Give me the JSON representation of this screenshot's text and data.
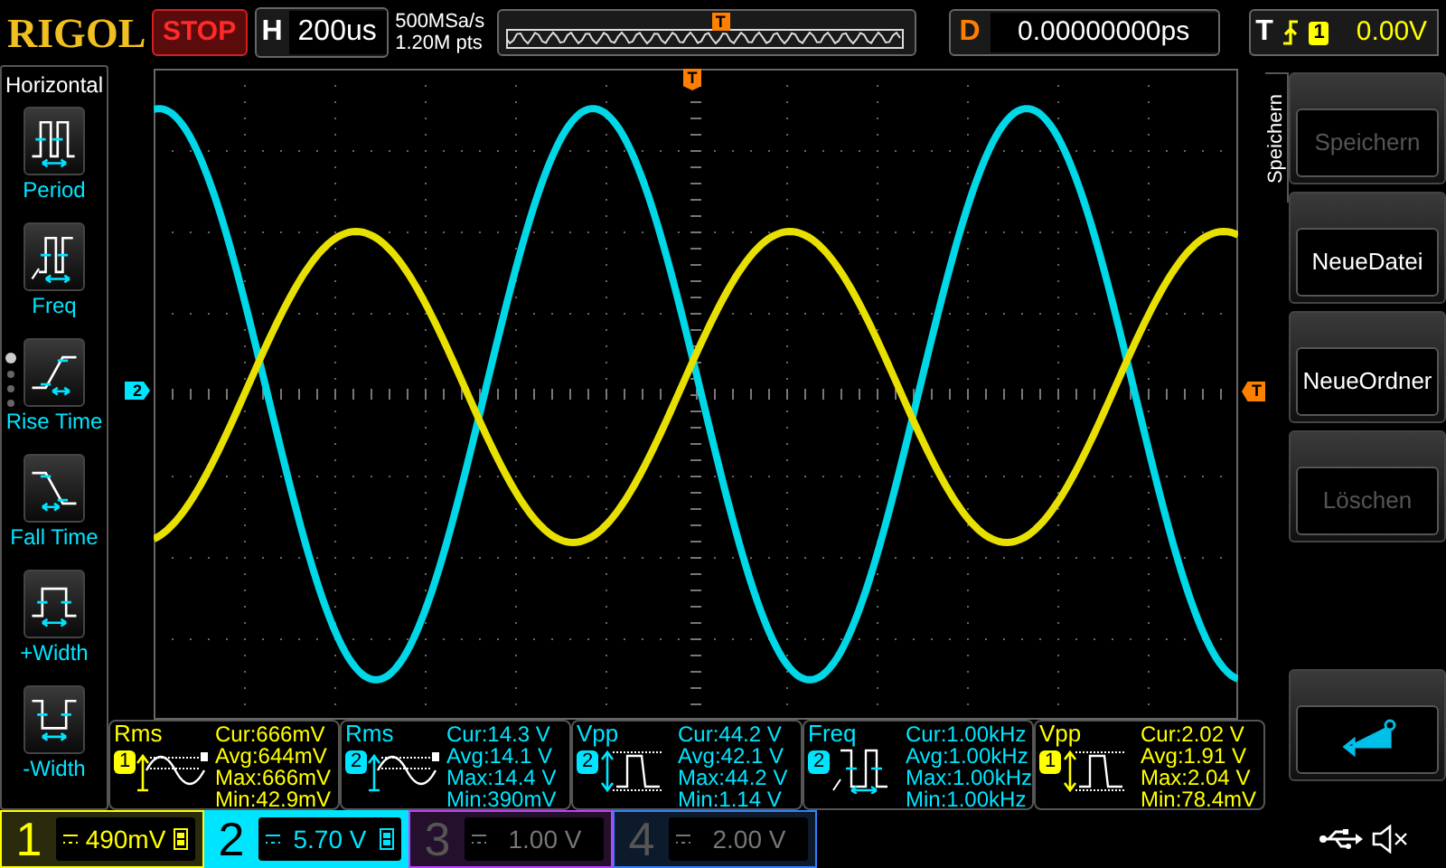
{
  "top_bar": {
    "logo": "RIGOL",
    "run_state": "STOP",
    "horizontal": {
      "label": "H",
      "timebase": "200us"
    },
    "sample_rate": "500MSa/s",
    "memory_depth": "1.20M pts",
    "memory_trigger": "T",
    "delay": {
      "label": "D",
      "value": "0.00000000ps"
    },
    "trigger": {
      "label": "T",
      "source": "1",
      "trigger_level": "0.00V"
    }
  },
  "sidebar": {
    "title": "Horizontal",
    "items": [
      {
        "label": "Period",
        "kind": "period"
      },
      {
        "label": "Freq",
        "kind": "freq"
      },
      {
        "label": "Rise Time",
        "kind": "rise"
      },
      {
        "label": "Fall Time",
        "kind": "fall"
      },
      {
        "label": "+Width",
        "kind": "pwidth"
      },
      {
        "label": "-Width",
        "kind": "nwidth"
      }
    ],
    "pages": [
      {
        "selected": true
      },
      {
        "selected": false
      },
      {
        "selected": false
      },
      {
        "selected": false
      }
    ]
  },
  "display": {
    "channel_marker": "2",
    "trigger_position_marker": "T",
    "trigger_level_marker": "T"
  },
  "measurements": [
    {
      "type": "Rms",
      "kind": "rms",
      "channel": "1",
      "color": "#ffff00",
      "cur": "Cur:666mV",
      "avg": "Avg:644mV",
      "max": "Max:666mV",
      "min": "Min:42.9mV"
    },
    {
      "type": "Rms",
      "kind": "rms",
      "channel": "2",
      "color": "#00e5ff",
      "cur": "Cur:14.3 V",
      "avg": "Avg:14.1 V",
      "max": "Max:14.4 V",
      "min": "Min:390mV"
    },
    {
      "type": "Vpp",
      "kind": "vpp",
      "channel": "2",
      "color": "#00e5ff",
      "cur": "Cur:44.2 V",
      "avg": "Avg:42.1 V",
      "max": "Max:44.2 V",
      "min": "Min:1.14 V"
    },
    {
      "type": "Freq",
      "kind": "freq",
      "channel": "2",
      "color": "#00e5ff",
      "cur": "Cur:1.00kHz",
      "avg": "Avg:1.00kHz",
      "max": "Max:1.00kHz",
      "min": "Min:1.00kHz"
    },
    {
      "type": "Vpp",
      "kind": "vpp",
      "channel": "1",
      "color": "#ffff00",
      "cur": "Cur:2.02 V",
      "avg": "Avg:1.91 V",
      "max": "Max:2.04 V",
      "min": "Min:78.4mV"
    }
  ],
  "menu": {
    "tab": "Speichern",
    "buttons": [
      {
        "kind": "text",
        "label": "Speichern",
        "disabled": true
      },
      {
        "kind": "text",
        "label": "NeueDatei",
        "disabled": false
      },
      {
        "kind": "text",
        "label": "NeueOrdner",
        "disabled": false
      },
      {
        "kind": "text",
        "label": "Löschen",
        "disabled": true
      },
      {
        "kind": "back"
      }
    ]
  },
  "channels": [
    {
      "number": "1",
      "scale": "490mV",
      "enabled": true,
      "selected": false,
      "color": "#ffff00"
    },
    {
      "number": "2",
      "scale": "5.70 V",
      "enabled": true,
      "selected": true,
      "color": "#00e5ff"
    },
    {
      "number": "3",
      "scale": "1.00 V",
      "enabled": false,
      "selected": false,
      "color": "#c040ff"
    },
    {
      "number": "4",
      "scale": "2.00 V",
      "enabled": false,
      "selected": false,
      "color": "#3080ff"
    }
  ]
}
